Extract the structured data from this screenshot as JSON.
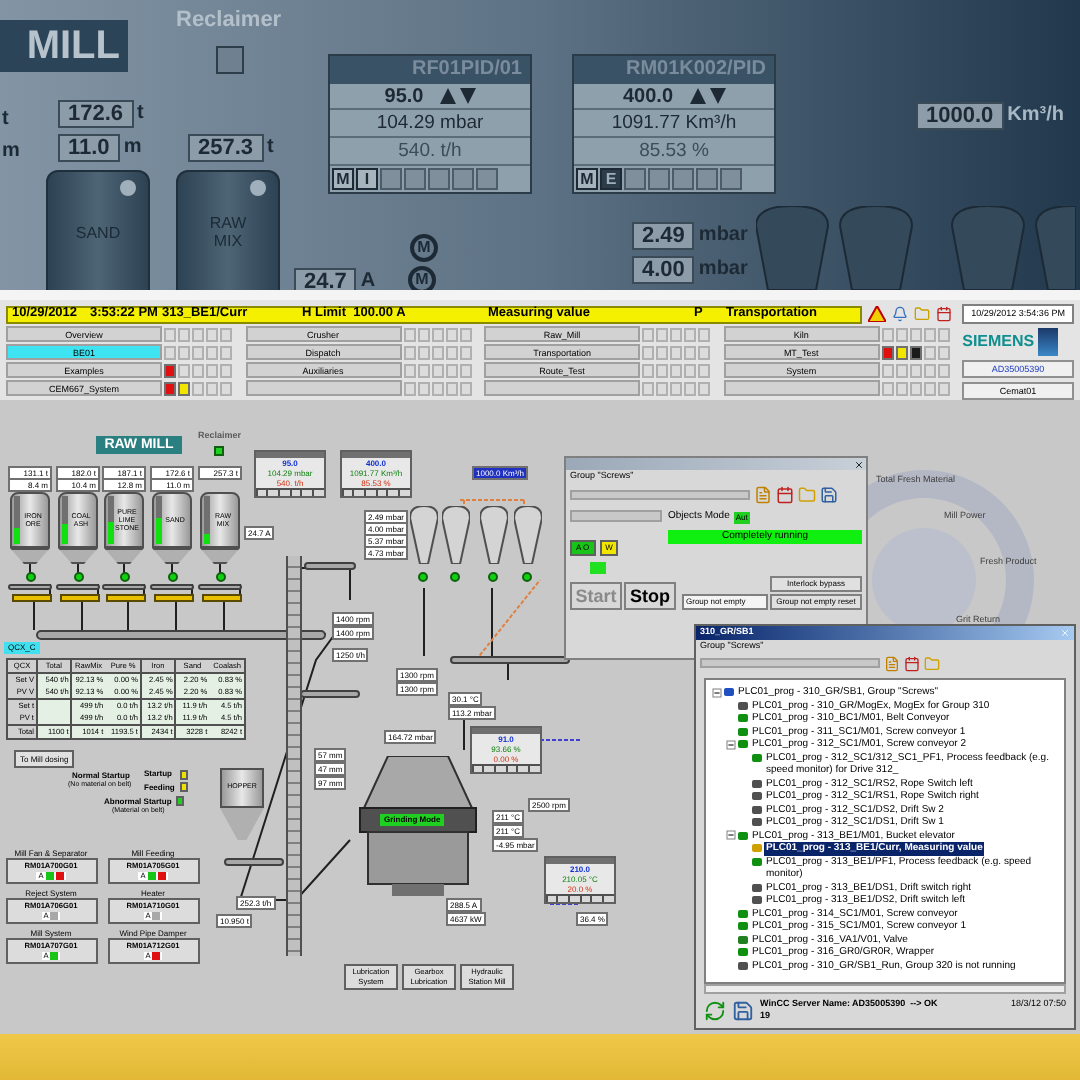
{
  "banner": {
    "title": "MILL",
    "label": "Reclaimer",
    "edge_units": [
      "t",
      "m"
    ],
    "readings": [
      {
        "value": "172.6",
        "unit": "t"
      },
      {
        "value": "11.0",
        "unit": "m"
      },
      {
        "value": "257.3",
        "unit": "t"
      },
      {
        "value": "24.7",
        "unit": "A"
      },
      {
        "value": "2.49",
        "unit": "mbar"
      },
      {
        "value": "4.00",
        "unit": "mbar"
      },
      {
        "value": "1000.0",
        "unit": "Km³/h"
      }
    ],
    "silos": [
      "SAND",
      "RAW MIX"
    ],
    "motor_labels": [
      "M",
      "M"
    ],
    "faceplates": [
      {
        "tag": "RF01PID/01",
        "setpoint": "95.0",
        "value": "104.29 mbar",
        "output": "540. t/h",
        "modes": [
          {
            "label": "M",
            "selected": false
          },
          {
            "label": "I",
            "selected": false
          }
        ]
      },
      {
        "tag": "RM01K002/PID",
        "setpoint": "400.0",
        "value": "1091.77 Km³/h",
        "output": "85.53 %",
        "modes": [
          {
            "label": "M",
            "selected": false
          },
          {
            "label": "E",
            "selected": true
          }
        ]
      }
    ]
  },
  "alarm_bar": {
    "date": "10/29/2012",
    "time": "3:53:22 PM",
    "tag": "313_BE1/Curr",
    "limit": "H Limit  100.00 A",
    "message": "Measuring value",
    "priority": "P",
    "area": "Transportation",
    "clock": "10/29/2012 3:54:36 PM"
  },
  "nav": {
    "columns": [
      [
        {
          "label": "Overview",
          "selected": false
        },
        {
          "label": "BE01",
          "selected": true
        },
        {
          "label": "Examples",
          "selected": false,
          "alarms": [
            {
              "kind": "fault"
            }
          ]
        },
        {
          "label": "CEM667_System",
          "selected": false,
          "alarms": [
            {
              "kind": "fault"
            },
            {
              "kind": "warning"
            }
          ]
        }
      ],
      [
        {
          "label": "Crusher",
          "selected": false
        },
        {
          "label": "Dispatch",
          "selected": false
        },
        {
          "label": "Auxiliaries",
          "selected": false
        }
      ],
      [
        {
          "label": "Raw_Mill",
          "selected": false
        },
        {
          "label": "Transportation",
          "selected": false
        },
        {
          "label": "Route_Test",
          "selected": false
        }
      ],
      [
        {
          "label": "Kiln",
          "selected": false
        },
        {
          "label": "MT_Test",
          "selected": false,
          "alarms": [
            {
              "kind": "fault"
            },
            {
              "kind": "warning"
            },
            {
              "kind": "maintenance"
            }
          ]
        },
        {
          "label": "System",
          "selected": false
        }
      ]
    ],
    "logo": "SIEMENS",
    "server": "AD35005390",
    "user": "Cemat01"
  },
  "process": {
    "title": "RAW MILL",
    "label": "Reclaimer",
    "tag": "QCX_C",
    "silos": [
      {
        "name": "IRON ORE",
        "weight": "131.1 t",
        "height": "8.4 m",
        "level": 0.35
      },
      {
        "name": "COAL ASH",
        "weight": "182.0 t",
        "height": "10.4 m",
        "level": 0.4
      },
      {
        "name": "PURE LIME STONE",
        "weight": "187.1 t",
        "height": "12.8 m",
        "level": 0.45
      },
      {
        "name": "SAND",
        "weight": "172.6 t",
        "height": "11.0 m",
        "level": 0.55
      },
      {
        "name": "RAW MIX",
        "weight": "257.3 t",
        "level": 0.2
      }
    ],
    "faceplates": [
      {
        "setpoint": "95.0",
        "value": "104.29 mbar",
        "output": "540. t/h"
      },
      {
        "setpoint": "400.0",
        "value": "1091.77 Km³/h",
        "output": "85.53 %"
      },
      {
        "setpoint": "91.0",
        "value": "93.66 %",
        "output": "0.00 %"
      },
      {
        "setpoint": "210.0",
        "value": "210.05 °C",
        "output": "20.0 %"
      }
    ],
    "readings": [
      "24.7 A",
      "2.49 mbar",
      "4.00 mbar",
      "5.37 mbar",
      "4.73 mbar",
      "1000.0 Km³/h",
      "1400 rpm",
      "1400 rpm",
      "1250 t/h",
      "1300 rpm",
      "1300 rpm",
      "30.1 °C",
      "113.2 mbar",
      "164.72 mbar",
      "57 mm",
      "47 mm",
      "97 mm",
      "211 °C",
      "211 °C",
      "-4.95 mbar",
      "2500 rpm",
      "252.3 t/h",
      "10.950 t",
      "288.5 A",
      "4637 kW",
      "36.4 %"
    ],
    "table": {
      "columns": [
        "QCX",
        "Total",
        "RawMix",
        "Pure %",
        "Iron",
        "Sand",
        "Coalash"
      ],
      "rows": [
        [
          "Set V",
          "540 t/h",
          "92.13 %",
          "0.00 %",
          "2.45 %",
          "2.20 %",
          "0.83 %"
        ],
        [
          "PV V",
          "540 t/h",
          "92.13 %",
          "0.00 %",
          "2.45 %",
          "2.20 %",
          "0.83 %"
        ],
        [
          "Set t",
          "",
          "499 t/h",
          "0.0 t/h",
          "13.2 t/h",
          "11.9 t/h",
          "4.5 t/h"
        ],
        [
          "PV t",
          "",
          "499 t/h",
          "0.0 t/h",
          "13.2 t/h",
          "11.9 t/h",
          "4.5 t/h"
        ],
        [
          "Total",
          "1100 t",
          "1014 t",
          "1193.5 t",
          "2434 t",
          "3228 t",
          "8242 t"
        ]
      ]
    },
    "dosing_button": "To Mill dosing",
    "startup": {
      "normal": "Normal Startup",
      "normal_note": "(No material on belt)",
      "startup": "Startup",
      "feeding": "Feeding",
      "abnormal": "Abnormal Startup",
      "abnormal_note": "(Material on belt)"
    },
    "hopper": "HOPPER",
    "mill_mode": "Grinding Mode",
    "groups": [
      {
        "title": "Mill Fan & Separator",
        "tag": "RM01A700G01",
        "mode": "A",
        "states": [
          {
            "kind": "running"
          },
          {
            "kind": "fault"
          }
        ]
      },
      {
        "title": "Mill Feeding",
        "tag": "RM01A705G01",
        "mode": "A",
        "states": [
          {
            "kind": "running"
          },
          {
            "kind": "fault"
          }
        ]
      },
      {
        "title": "Reject System",
        "tag": "RM01A706G01",
        "mode": "A",
        "states": [
          {
            "kind": "idle"
          }
        ]
      },
      {
        "title": "Heater",
        "tag": "RM01A710G01",
        "mode": "A",
        "states": [
          {
            "kind": "idle"
          }
        ]
      },
      {
        "title": "Mill System",
        "tag": "RM01A707G01",
        "mode": "A",
        "states": [
          {
            "kind": "running"
          }
        ]
      },
      {
        "title": "Wind Pipe Damper",
        "tag": "RM01A712G01",
        "mode": "A",
        "states": [
          {
            "kind": "fault"
          }
        ]
      }
    ],
    "lubrication": [
      "Lubrication System",
      "Gearbox Lubrication",
      "Hydraulic Station Mill"
    ],
    "flow_labels": [
      "Total Fresh Material",
      "Mill Power",
      "Fresh Product",
      "Grit Return"
    ]
  },
  "group_window": {
    "group": "Group \"Screws\"",
    "mode_label": "Objects Mode",
    "mode": "Aut",
    "status": "Completely running",
    "indicators": [
      {
        "label": "A O",
        "kind": "auto"
      },
      {
        "label": "W",
        "kind": "warning"
      }
    ],
    "buttons": [
      {
        "label": "Start",
        "disabled": true
      },
      {
        "label": "Stop",
        "disabled": false
      }
    ],
    "bypass": "Interlock bypass",
    "empty": "Group not empty",
    "reset": "Group not empty reset"
  },
  "tree_window": {
    "title": "310_GR/SB1",
    "group": "Group \"Screws\"",
    "status": "WinCC Server Name: AD35005390  --> OK",
    "count": "19",
    "date": "18/3/12 07:50",
    "items": [
      {
        "text": "PLC01_prog - 310_GR/SB1, Group \"Screws\"",
        "kind": "group",
        "expanded": true,
        "selected": false,
        "children": [
          {
            "text": "PLC01_prog - 310_GR/MogEx, MogEx for Group 310",
            "kind": "device",
            "selected": false
          },
          {
            "text": "PLC01_prog - 310_BC1/M01, Belt Conveyor",
            "kind": "motor",
            "selected": false
          },
          {
            "text": "PLC01_prog - 311_SC1/M01, Screw conveyor 1",
            "kind": "motor",
            "selected": false
          },
          {
            "text": "PLC01_prog - 312_SC1/M01, Screw conveyor 2",
            "kind": "motor",
            "expanded": true,
            "selected": false,
            "children": [
              {
                "text": "PLC01_prog - 312_SC1/312_SC1_PF1, Process feedback (e.g. speed monitor) for Drive 312_",
                "kind": "motor",
                "selected": false
              },
              {
                "text": "PLC01_prog - 312_SC1/RS2, Rope Switch left",
                "kind": "device",
                "selected": false
              },
              {
                "text": "PLC01_prog - 312_SC1/RS1, Rope Switch right",
                "kind": "device",
                "selected": false
              },
              {
                "text": "PLC01_prog - 312_SC1/DS2, Drift Sw 2",
                "kind": "device",
                "selected": false
              },
              {
                "text": "PLC01_prog - 312_SC1/DS1, Drift Sw 1",
                "kind": "device",
                "selected": false
              }
            ]
          },
          {
            "text": "PLC01_prog - 313_BE1/M01, Bucket elevator",
            "kind": "motor",
            "expanded": true,
            "selected": false,
            "children": [
              {
                "text": "PLC01_prog - 313_BE1/Curr, Measuring value",
                "kind": "measure",
                "selected": true
              },
              {
                "text": "PLC01_prog - 313_BE1/PF1, Process feedback (e.g. speed monitor)",
                "kind": "motor",
                "selected": false
              },
              {
                "text": "PLC01_prog - 313_BE1/DS1, Drift switch right",
                "kind": "device",
                "selected": false
              },
              {
                "text": "PLC01_prog - 313_BE1/DS2, Drift switch left",
                "kind": "device",
                "selected": false
              }
            ]
          },
          {
            "text": "PLC01_prog - 314_SC1/M01, Screw conveyor",
            "kind": "motor",
            "selected": false
          },
          {
            "text": "PLC01_prog - 315_SC1/M01, Screw conveyor 1",
            "kind": "motor",
            "selected": false
          },
          {
            "text": "PLC01_prog - 316_VA1/V01, Valve",
            "kind": "valve",
            "selected": false
          },
          {
            "text": "PLC01_prog - 316_GR0/GR0R, Wrapper",
            "kind": "motor",
            "selected": false
          },
          {
            "text": "PLC01_prog - 310_GR/SB1_Run, Group 320 is not running",
            "kind": "device",
            "selected": false
          }
        ]
      }
    ]
  }
}
